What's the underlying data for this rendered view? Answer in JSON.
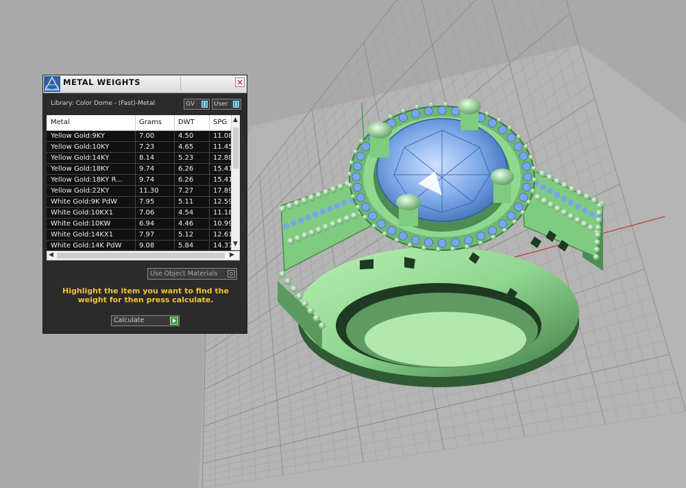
{
  "panel": {
    "title": "METAL WEIGHTS",
    "close_symbol": "×",
    "library_label": "Library: Color Dome - (Fast)-Metal",
    "toggles": [
      {
        "label": "GV",
        "icon": "toggle-switch-icon"
      },
      {
        "label": "User",
        "icon": "toggle-switch-icon"
      }
    ],
    "table": {
      "columns": [
        "Metal",
        "Grams",
        "DWT",
        "SPG"
      ],
      "rows": [
        [
          "Yellow Gold:9KY",
          "7.00",
          "4.50",
          "11.08"
        ],
        [
          "Yellow Gold:10KY",
          "7.23",
          "4.65",
          "11.45"
        ],
        [
          "Yellow Gold:14KY",
          "8.14",
          "5.23",
          "12.88"
        ],
        [
          "Yellow Gold:18KY",
          "9.74",
          "6.26",
          "15.41"
        ],
        [
          "Yellow Gold:18KY R...",
          "9.74",
          "6.26",
          "15.41"
        ],
        [
          "Yellow Gold:22KY",
          "11.30",
          "7.27",
          "17.89"
        ],
        [
          "White Gold:9K PdW",
          "7.95",
          "5.11",
          "12.59"
        ],
        [
          "White Gold:10KX1",
          "7.06",
          "4.54",
          "11.18"
        ],
        [
          "White Gold:10KW",
          "6.94",
          "4.46",
          "10.99"
        ],
        [
          "White Gold:14KX1",
          "7.97",
          "5.12",
          "12.61"
        ],
        [
          "White Gold:14K PdW",
          "9.08",
          "5.84",
          "14.37"
        ]
      ]
    },
    "use_object_materials_label": "Use Object Materials",
    "hint_text": "Highlight the item you want to find the weight for then press calculate.",
    "calculate_label": "Calculate"
  },
  "colors": {
    "panel_bg": "#2b2b2b",
    "hint": "#f2c230",
    "ring_metal": "#9fe0a0",
    "gemstone": "#7aa6e6",
    "viewport_bg": "#a9a9a9"
  }
}
